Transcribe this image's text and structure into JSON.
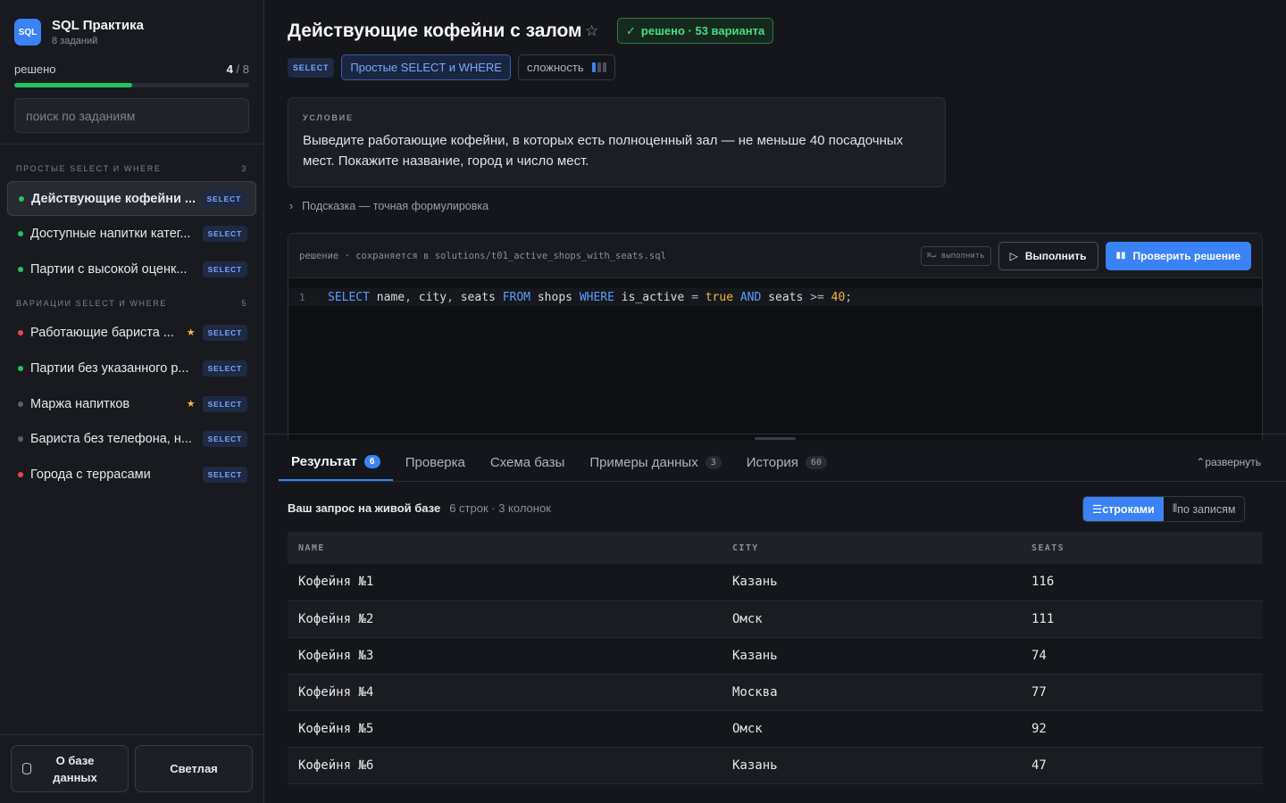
{
  "app": {
    "logo": "SQL",
    "title": "SQL Практика",
    "subtitle": "8 заданий"
  },
  "progress": {
    "label": "решено",
    "solved": "4",
    "total": "/ 8",
    "fraction": 0.5
  },
  "search": {
    "placeholder": "поиск по заданиям"
  },
  "groups": [
    {
      "title": "ПРОСТЫЕ SELECT И WHERE",
      "count": "3"
    },
    {
      "title": "ВАРИАЦИИ SELECT И WHERE",
      "count": "5"
    }
  ],
  "tasks": [
    {
      "label": "Действующие кофейни ...",
      "tag": "SELECT",
      "status": "solved",
      "starred": false,
      "active": true
    },
    {
      "label": "Доступные напитки катег...",
      "tag": "SELECT",
      "status": "solved",
      "starred": false
    },
    {
      "label": "Партии с высокой оценк...",
      "tag": "SELECT",
      "status": "solved",
      "starred": false
    },
    {
      "label": "Работающие бариста ...",
      "tag": "SELECT",
      "status": "failed",
      "starred": true
    },
    {
      "label": "Партии без указанного р...",
      "tag": "SELECT",
      "status": "solved",
      "starred": false
    },
    {
      "label": "Маржа напитков",
      "tag": "SELECT",
      "status": "todo",
      "starred": true
    },
    {
      "label": "Бариста без телефона, н...",
      "tag": "SELECT",
      "status": "todo",
      "starred": false
    },
    {
      "label": "Города с террасами",
      "tag": "SELECT",
      "status": "failed",
      "starred": false
    }
  ],
  "footer": {
    "db_button": "О базе данных",
    "theme_button": "Светлая"
  },
  "task": {
    "title": "Действующие кофейни с залом",
    "solved_badge": "решено · 53 варианта",
    "tag": "SELECT",
    "topic": "Простые SELECT и WHERE",
    "difficulty_label": "сложность",
    "difficulty_level": 1,
    "condition_heading": "УСЛОВИЕ",
    "condition_text": "Выведите работающие кофейни, в которых есть полноценный зал — не меньше 40 посадочных мест. Покажите название, город и число мест.",
    "hint": "Подсказка — точная формулировка"
  },
  "editor": {
    "path": "решение · сохраняется в solutions/t01_active_shops_with_seats.sql",
    "shortcut": "⌘↵ выполнить",
    "run_label": "Выполнить",
    "check_label": "Проверить решение",
    "line_number": "1",
    "code": {
      "k1": "SELECT",
      "c1": "name",
      "s1": ",",
      "c2": "city",
      "s2": ",",
      "c3": "seats",
      "k2": "FROM",
      "t1": "shops",
      "k3": "WHERE",
      "c4": "is_active",
      "o1": "=",
      "v1": "true",
      "k4": "AND",
      "c5": "seats",
      "o2": ">=",
      "v2": "40",
      "end": ";"
    }
  },
  "tabs": [
    {
      "label": "Результат",
      "count": "6",
      "active": true
    },
    {
      "label": "Проверка"
    },
    {
      "label": "Схема базы"
    },
    {
      "label": "Примеры данных",
      "count": "3"
    },
    {
      "label": "История",
      "count": "60"
    }
  ],
  "expand_label": "развернуть",
  "result": {
    "heading": "Ваш запрос на живой базе",
    "meta": "6 строк · 3 колонок",
    "view_rows": "строками",
    "view_records": "по записям",
    "columns": [
      "NAME",
      "CITY",
      "SEATS"
    ],
    "rows": [
      [
        "Кофейня №1",
        "Казань",
        "116"
      ],
      [
        "Кофейня №2",
        "Омск",
        "111"
      ],
      [
        "Кофейня №3",
        "Казань",
        "74"
      ],
      [
        "Кофейня №4",
        "Москва",
        "77"
      ],
      [
        "Кофейня №5",
        "Омск",
        "92"
      ],
      [
        "Кофейня №6",
        "Казань",
        "47"
      ]
    ]
  },
  "colors": {
    "accent": "#3b82f6",
    "success": "#22c55e",
    "danger": "#ef4444",
    "star": "#f5b93a"
  }
}
